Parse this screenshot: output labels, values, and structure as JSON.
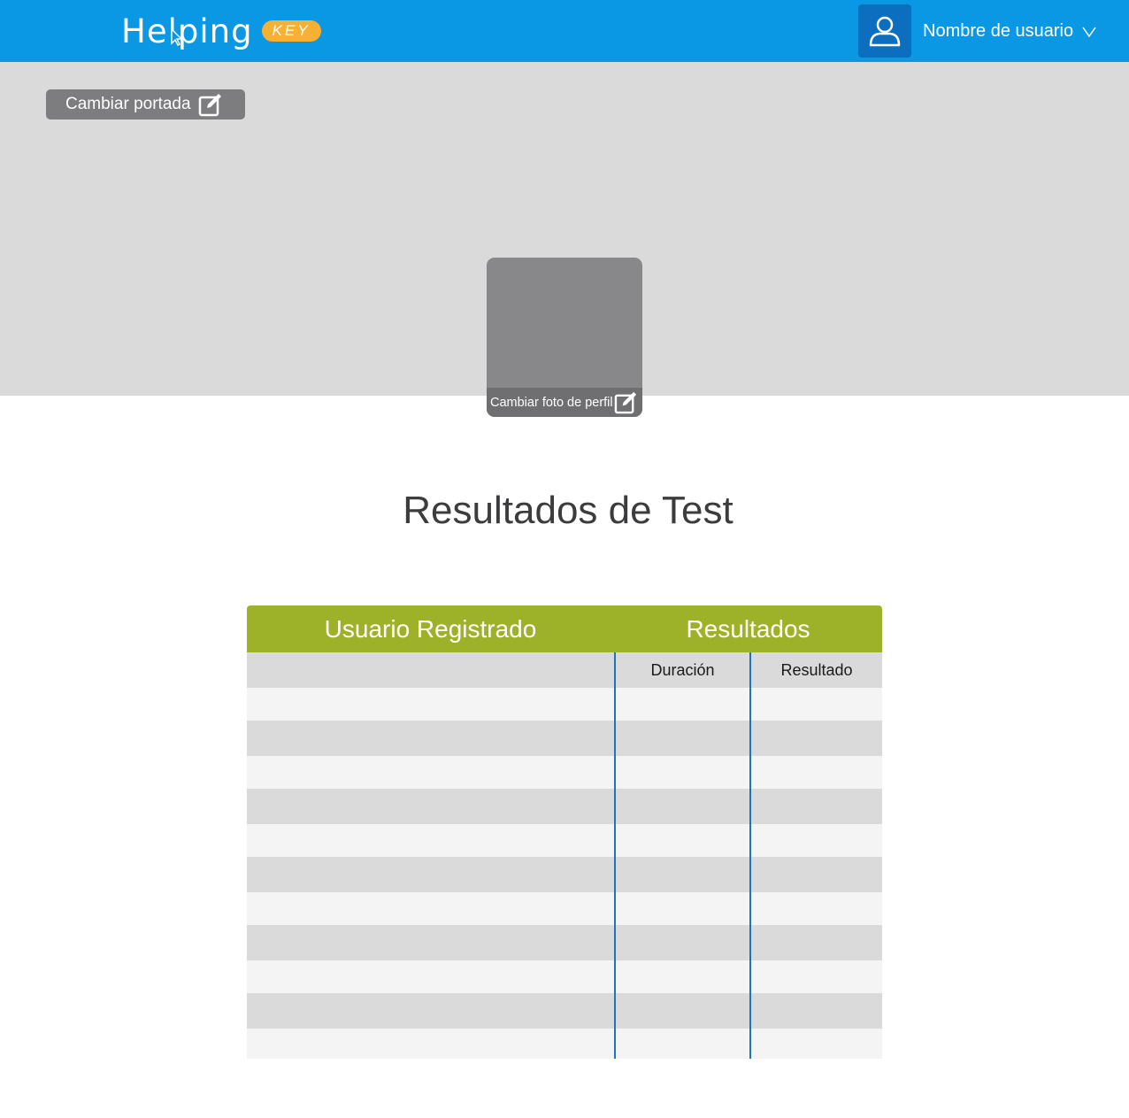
{
  "header": {
    "logo_text": "Helping",
    "logo_badge": "KEY",
    "username": "Nombre de usuario",
    "brand_color": "#0a98e4"
  },
  "cover": {
    "change_cover_label": "Cambiar portada"
  },
  "profile": {
    "change_photo_label": "Cambiar foto de perfil"
  },
  "main": {
    "title": "Resultados de Test"
  },
  "table": {
    "header_user": "Usuario Registrado",
    "header_results": "Resultados",
    "sub_duration": "Duración",
    "sub_result": "Resultado",
    "accent_color": "#9db228",
    "rows": [
      {
        "user": "",
        "duration": "",
        "result": ""
      },
      {
        "user": "",
        "duration": "",
        "result": ""
      },
      {
        "user": "",
        "duration": "",
        "result": ""
      },
      {
        "user": "",
        "duration": "",
        "result": ""
      },
      {
        "user": "",
        "duration": "",
        "result": ""
      },
      {
        "user": "",
        "duration": "",
        "result": ""
      },
      {
        "user": "",
        "duration": "",
        "result": ""
      },
      {
        "user": "",
        "duration": "",
        "result": ""
      },
      {
        "user": "",
        "duration": "",
        "result": ""
      },
      {
        "user": "",
        "duration": "",
        "result": ""
      },
      {
        "user": "",
        "duration": "",
        "result": ""
      }
    ]
  }
}
